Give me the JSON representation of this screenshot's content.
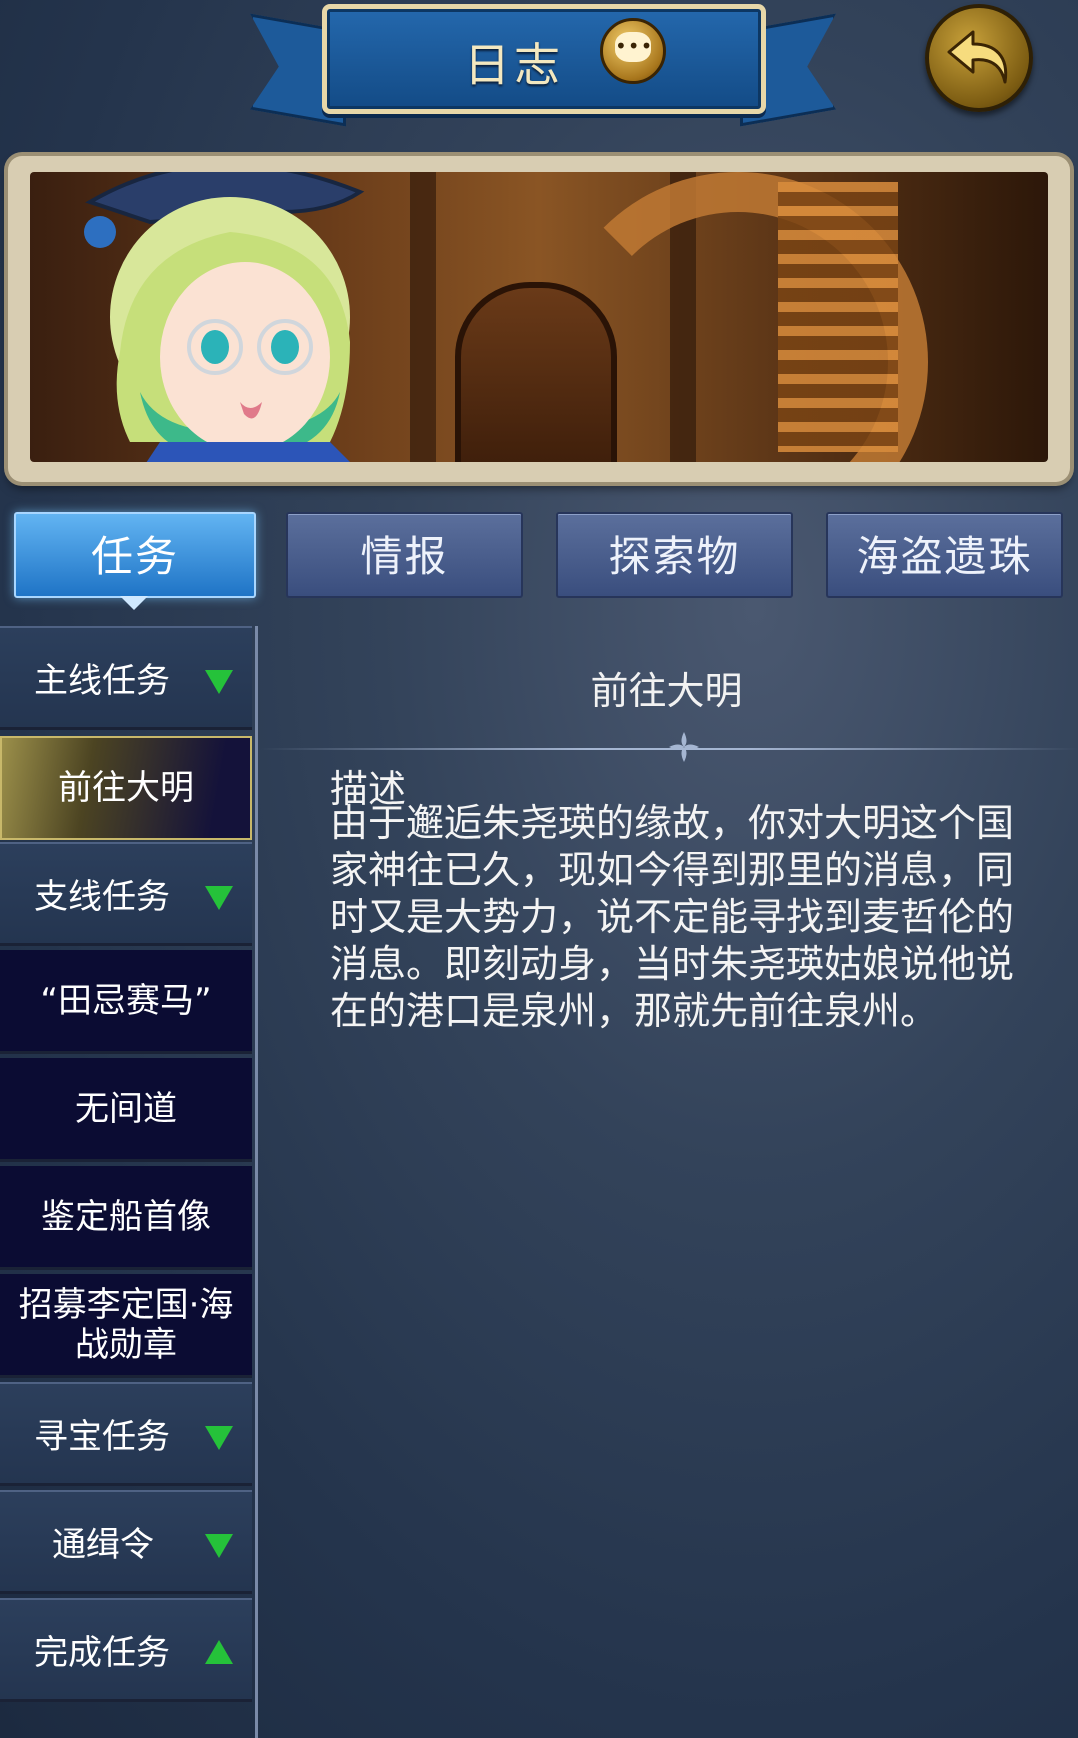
{
  "header": {
    "title": "日志",
    "chat_icon": "chat-bubble-icon",
    "back_icon": "back-arrow-icon"
  },
  "tabs": [
    {
      "label": "任务",
      "active": true
    },
    {
      "label": "情报",
      "active": false
    },
    {
      "label": "探索物",
      "active": false
    },
    {
      "label": "海盗遗珠",
      "active": false
    }
  ],
  "sidebar": {
    "items": [
      {
        "label": "主线任务",
        "type": "category",
        "expanded": true
      },
      {
        "label": "前往大明",
        "type": "task",
        "selected": true
      },
      {
        "label": "支线任务",
        "type": "category",
        "expanded": true
      },
      {
        "label": "“田忌赛马”",
        "type": "task"
      },
      {
        "label": "无间道",
        "type": "task"
      },
      {
        "label": "鉴定船首像",
        "type": "task"
      },
      {
        "label": "招募李定国·海战勋章",
        "type": "task"
      },
      {
        "label": "寻宝任务",
        "type": "category",
        "expanded": true
      },
      {
        "label": "通缉令",
        "type": "category",
        "expanded": true
      },
      {
        "label": "完成任务",
        "type": "category",
        "expanded": false
      }
    ]
  },
  "detail": {
    "title": "前往大明",
    "desc_heading": "描述",
    "description": "由于邂逅朱尧瑛的缘故，你对大明这个国家神往已久，现如今得到那里的消息，同时又是大势力，说不定能寻找到麦哲伦的消息。即刻动身，当时朱尧瑛姑娘说他说在的港口是泉州，那就先前往泉州。"
  },
  "colors": {
    "active_tab": "#2f8ae0",
    "arrow": "#25c23a",
    "selected_item": "#9b8f4a"
  }
}
